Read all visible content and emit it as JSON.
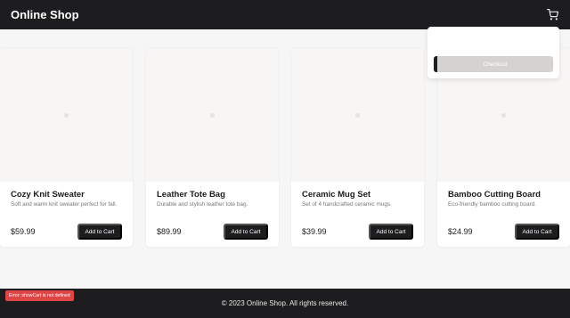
{
  "header": {
    "brand": "Online Shop",
    "cart_icon": "shopping-cart-icon"
  },
  "cart_panel": {
    "checkout_label": "Checkout"
  },
  "products": [
    {
      "title": "Cozy Knit Sweater",
      "description": "Soft and warm knit sweater perfect for fall.",
      "price": "$59.99",
      "button": "Add to Cart"
    },
    {
      "title": "Leather Tote Bag",
      "description": "Durable and stylish leather tote bag.",
      "price": "$89.99",
      "button": "Add to Cart"
    },
    {
      "title": "Ceramic Mug Set",
      "description": "Set of 4 handcrafted ceramic mugs.",
      "price": "$39.99",
      "button": "Add to Cart"
    },
    {
      "title": "Bamboo Cutting Board",
      "description": "Eco-friendly bamboo cutting board.",
      "price": "$24.99",
      "button": "Add to Cart"
    }
  ],
  "footer": {
    "copyright": "© 2023 Online Shop. All rights reserved."
  },
  "error": {
    "message": "Error: showCart is not defined"
  },
  "colors": {
    "dark": "#1d1d1f",
    "error": "#e04545"
  }
}
